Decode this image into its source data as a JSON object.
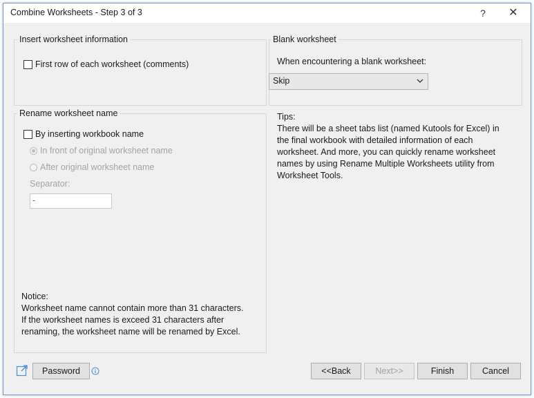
{
  "window": {
    "title": "Combine Worksheets - Step 3 of 3",
    "help_label": "?",
    "close_label": "✕"
  },
  "insert_info": {
    "legend": "Insert worksheet information",
    "first_row_label": "First row of each worksheet (comments)"
  },
  "blank": {
    "legend": "Blank worksheet",
    "prompt": "When encountering a blank worksheet:",
    "selected": "Skip"
  },
  "rename": {
    "legend": "Rename worksheet name",
    "by_workbook_label": "By inserting workbook name",
    "in_front_label": "In front of original worksheet name",
    "after_label": "After original worksheet name",
    "separator_label": "Separator:",
    "separator_value": "-"
  },
  "notice": {
    "title": "Notice:",
    "lines": [
      "Worksheet name cannot contain more than 31 characters.",
      "If the worksheet names is exceed 31 characters after",
      "renaming, the worksheet name will be renamed by Excel."
    ]
  },
  "tips": {
    "title": "Tips:",
    "lines": [
      "There will be a sheet tabs list (named Kutools for Excel) in",
      "the final workbook with detailed information of each",
      "worksheet. And more, you can quickly rename worksheet",
      "names by using Rename Multiple Worksheets utility from",
      "Worksheet Tools."
    ]
  },
  "footer": {
    "password_label": "Password",
    "back_label": "<<Back",
    "next_label": "Next>>",
    "finish_label": "Finish",
    "cancel_label": "Cancel"
  },
  "colors": {
    "accent": "#4a8fd6",
    "border": "#d7d7d7",
    "disabled_text": "#a3a3a3"
  }
}
